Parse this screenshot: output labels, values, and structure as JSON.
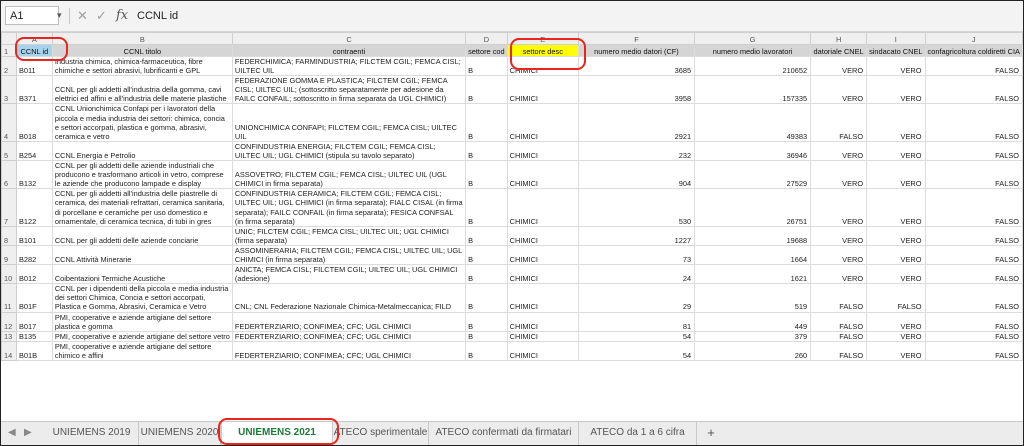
{
  "formula_bar": {
    "cell_reference": "A1",
    "dropdown_icon": "chevron-down-icon",
    "cancel_icon": "cross-icon",
    "confirm_icon": "check-icon",
    "fx_label": "fx",
    "content": "CCNL id"
  },
  "columns": [
    "A",
    "B",
    "C",
    "D",
    "E",
    "F",
    "G",
    "H",
    "I",
    "J"
  ],
  "fields": [
    "CCNL id",
    "CCNL titolo",
    "contraenti",
    "settore cod",
    "settore desc",
    "numero medio datori (CF)",
    "numero medio lavoratori",
    "datoriale CNEL",
    "sindacato CNEL",
    "confagricoltura coldiretti CIA"
  ],
  "rows": [
    {
      "n": "2",
      "id": "B011",
      "titolo": "Industria chimica, chimica-farmaceutica, fibre chimiche e settori abrasivi, lubrificanti e GPL",
      "contraenti": "FEDERCHIMICA; FARMINDUSTRIA; FILCTEM CGIL; FEMCA CISL; UILTEC UIL",
      "cod": "B",
      "desc": "CHIMICI",
      "datori": "3685",
      "lavoratori": "210652",
      "cnel_dat": "VERO",
      "cnel_sind": "VERO",
      "agri": "FALSO"
    },
    {
      "n": "3",
      "id": "B371",
      "titolo": "CCNL per gli addetti all'industria della gomma, cavi elettrici ed affini e all'industria delle materie plastiche",
      "contraenti": "FEDERAZIONE GOMMA E PLASTICA; FILCTEM CGIL; FEMCA CISL; UILTEC UIL; (sottoscritto separatamente per adesione da FAILC CONFAIL; sottoscritto in firma separata da UGL CHIMICI)",
      "cod": "B",
      "desc": "CHIMICI",
      "datori": "3958",
      "lavoratori": "157335",
      "cnel_dat": "VERO",
      "cnel_sind": "VERO",
      "agri": "FALSO"
    },
    {
      "n": "4",
      "id": "B018",
      "titolo": "CCNL Unionchimica Confapi per i lavoratori della piccola e media industria dei settori: chimica, concia e settori accorpati, plastica e gomma, abrasivi, ceramica e vetro",
      "contraenti": "UNIONCHIMICA CONFAPI; FILCTEM CGIL; FEMCA CISL; UILTEC UIL",
      "cod": "B",
      "desc": "CHIMICI",
      "datori": "2921",
      "lavoratori": "49383",
      "cnel_dat": "FALSO",
      "cnel_sind": "VERO",
      "agri": "FALSO"
    },
    {
      "n": "5",
      "id": "B254",
      "titolo": "CCNL Energia e Petrolio",
      "contraenti": "CONFINDUSTRIA ENERGIA; FILCTEM CGIL; FEMCA CISL; UILTEC UIL; UGL CHIMICI (stipula su tavolo separato)",
      "cod": "B",
      "desc": "CHIMICI",
      "datori": "232",
      "lavoratori": "36946",
      "cnel_dat": "VERO",
      "cnel_sind": "VERO",
      "agri": "FALSO"
    },
    {
      "n": "6",
      "id": "B132",
      "titolo": "CCNL per gli addetti delle aziende industriali che producono e trasformano articoli in vetro, comprese le aziende che producono lampade e display",
      "contraenti": "ASSOVETRO; FILCTEM CGIL; FEMCA CISL; UILTEC UIL (UGL CHIMICI in firma separata)",
      "cod": "B",
      "desc": "CHIMICI",
      "datori": "904",
      "lavoratori": "27529",
      "cnel_dat": "VERO",
      "cnel_sind": "VERO",
      "agri": "FALSO"
    },
    {
      "n": "7",
      "id": "B122",
      "titolo": "CCNL per gli addetti all'industria delle piastrelle di ceramica, dei materiali refrattari, ceramica sanitaria, di porcellane e ceramiche per uso domestico e ornamentale, di ceramica tecnica, di tubi in gres",
      "contraenti": "CONFINDUSTRIA CERAMICA; FILCTEM CGIL; FEMCA CISL; UILTEC UIL; UGL CHIMICI (in firma separata); FIALC CISAL (in firma separata); FAILC CONFAIL (in firma separata); FESICA CONFSAL (in firma separata)",
      "cod": "B",
      "desc": "CHIMICI",
      "datori": "530",
      "lavoratori": "26751",
      "cnel_dat": "VERO",
      "cnel_sind": "VERO",
      "agri": "FALSO"
    },
    {
      "n": "8",
      "id": "B101",
      "titolo": "CCNL per gli addetti delle aziende conciarie",
      "contraenti": "UNIC; FILCTEM CGIL; FEMCA CISL; UILTEC UIL; UGL CHIMICI (firma separata)",
      "cod": "B",
      "desc": "CHIMICI",
      "datori": "1227",
      "lavoratori": "19688",
      "cnel_dat": "VERO",
      "cnel_sind": "VERO",
      "agri": "FALSO"
    },
    {
      "n": "9",
      "id": "B282",
      "titolo": "CCNL Attività Minerarie",
      "contraenti": "ASSOMINERARIA; FILCTEM CGIL; FEMCA CISL; UILTEC UIL; UGL CHIMICI (in firma separata)",
      "cod": "B",
      "desc": "CHIMICI",
      "datori": "73",
      "lavoratori": "1664",
      "cnel_dat": "VERO",
      "cnel_sind": "VERO",
      "agri": "FALSO"
    },
    {
      "n": "10",
      "id": "B012",
      "titolo": "Coibentazioni Termiche Acustiche",
      "contraenti": "ANICTA; FEMCA CISL; FILCTEM CGIL; UILTEC UIL; UGL CHIMICI (adesione)",
      "cod": "B",
      "desc": "CHIMICI",
      "datori": "24",
      "lavoratori": "1621",
      "cnel_dat": "VERO",
      "cnel_sind": "VERO",
      "agri": "FALSO"
    },
    {
      "n": "11",
      "id": "B01F",
      "titolo": "CCNL per i dipendenti della piccola e media industria dei settori Chimica, Concia e settori accorpati, Plastica e Gomma, Abrasivi, Ceramica e Vetro",
      "contraenti": "CNL; CNL Federazione Nazionale Chimica-Metalmeccanica; FILD",
      "cod": "B",
      "desc": "CHIMICI",
      "datori": "29",
      "lavoratori": "519",
      "cnel_dat": "FALSO",
      "cnel_sind": "FALSO",
      "agri": "FALSO"
    },
    {
      "n": "12",
      "id": "B017",
      "titolo": "PMI, cooperative e aziende artigiane del settore plastica e gomma",
      "contraenti": "FEDERTERZIARIO; CONFIMEA; CFC; UGL CHIMICI",
      "cod": "B",
      "desc": "CHIMICI",
      "datori": "81",
      "lavoratori": "449",
      "cnel_dat": "FALSO",
      "cnel_sind": "VERO",
      "agri": "FALSO"
    },
    {
      "n": "13",
      "id": "B135",
      "titolo": "PMI, cooperative e aziende artigiane del settore vetro",
      "contraenti": "FEDERTERZIARIO; CONFIMEA; CFC; UGL CHIMICI",
      "cod": "B",
      "desc": "CHIMICI",
      "datori": "54",
      "lavoratori": "379",
      "cnel_dat": "FALSO",
      "cnel_sind": "VERO",
      "agri": "FALSO"
    },
    {
      "n": "14",
      "id": "B01B",
      "titolo": "PMI, cooperative e aziende artigiane del settore chimico e affini",
      "contraenti": "FEDERTERZIARIO; CONFIMEA; CFC; UGL CHIMICI",
      "cod": "B",
      "desc": "CHIMICI",
      "datori": "54",
      "lavoratori": "260",
      "cnel_dat": "FALSO",
      "cnel_sind": "VERO",
      "agri": "FALSO"
    }
  ],
  "sheet_tabs": [
    "UNIEMENS 2019",
    "UNIEMENS 2020",
    "UNIEMENS 2021",
    "ATECO sperimentale",
    "ATECO confermati da firmatari",
    "ATECO da 1 a 6 cifra"
  ],
  "active_tab": "UNIEMENS 2021",
  "add_sheet_label": "+",
  "colors": {
    "annotation": "#e8261e",
    "header_highlight": "#a6d2ec",
    "desc_highlight": "#ffff00",
    "active_tab_text": "#1f7a3a"
  }
}
